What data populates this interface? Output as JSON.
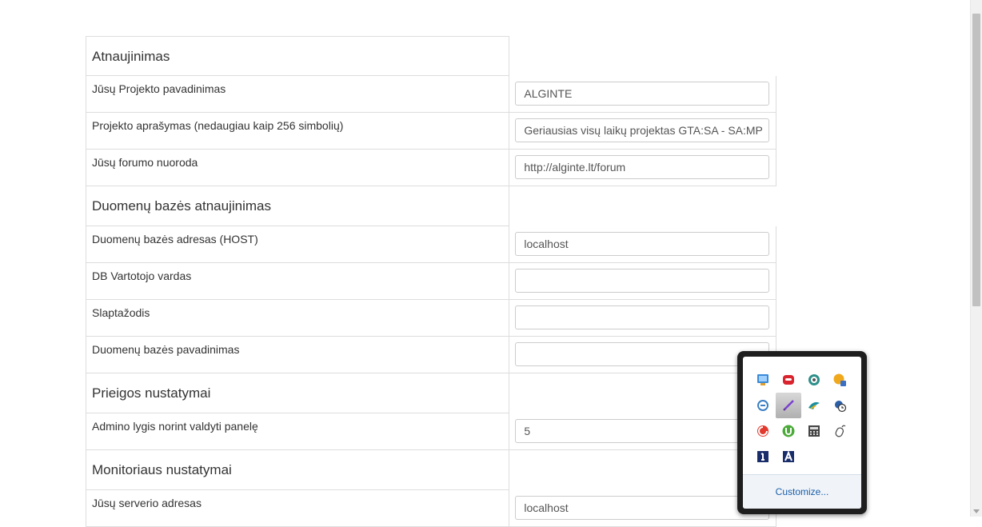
{
  "settings": {
    "sections": [
      {
        "title": "Atnaujinimas",
        "fields": [
          {
            "label": "Jūsų Projekto pavadinimas",
            "value": "ALGINTE"
          },
          {
            "label": "Projekto aprašymas (nedaugiau kaip 256 simbolių)",
            "value": "Geriausias visų laikų projektas GTA:SA - SA:MP"
          },
          {
            "label": "Jūsų forumo nuoroda",
            "value": "http://alginte.lt/forum"
          }
        ]
      },
      {
        "title": "Duomenų bazės atnaujinimas",
        "fields": [
          {
            "label": "Duomenų bazės adresas (HOST)",
            "value": "localhost"
          },
          {
            "label": "DB Vartotojo vardas",
            "value": ""
          },
          {
            "label": "Slaptažodis",
            "value": ""
          },
          {
            "label": "Duomenų bazės pavadinimas",
            "value": ""
          }
        ]
      },
      {
        "title": "Prieigos nustatymai",
        "fields": [
          {
            "label": "Admino lygis norint valdyti panelę",
            "value": "5"
          }
        ]
      },
      {
        "title": "Monitoriaus nustatymai",
        "fields": [
          {
            "label": "Jūsų serverio adresas",
            "value": "localhost"
          }
        ]
      }
    ]
  },
  "tray": {
    "icons": [
      "network-monitor-icon",
      "messenger-icon",
      "sync-icon",
      "media-icon",
      "voip-icon",
      "pen-tablet-icon",
      "bird-app-icon",
      "shield-clock-icon",
      "antivirus-icon",
      "utorrent-icon",
      "calculator-icon",
      "mouse-icon",
      "info-one-icon",
      "font-a-icon"
    ],
    "selected_index": 5,
    "customize_label": "Customize..."
  }
}
